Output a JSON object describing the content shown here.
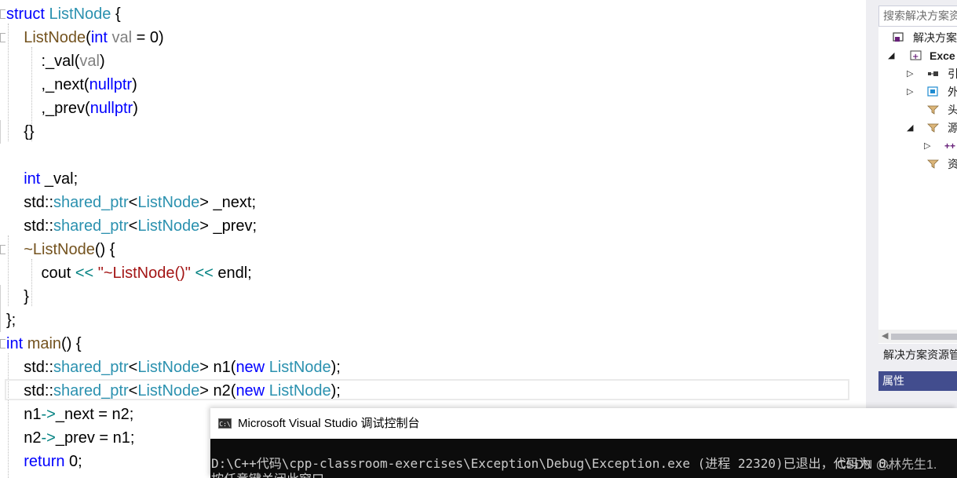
{
  "editor": {
    "lines": [
      [
        {
          "t": "struct",
          "c": "kw"
        },
        {
          "t": " "
        },
        {
          "t": "ListNode",
          "c": "ty"
        },
        {
          "t": " {"
        }
      ],
      [
        {
          "t": "    "
        },
        {
          "t": "ListNode",
          "c": "fn"
        },
        {
          "t": "("
        },
        {
          "t": "int",
          "c": "kw"
        },
        {
          "t": " "
        },
        {
          "t": "val",
          "c": "pr"
        },
        {
          "t": " = 0)"
        }
      ],
      [
        {
          "t": "        :_val("
        },
        {
          "t": "val",
          "c": "pr"
        },
        {
          "t": ")"
        }
      ],
      [
        {
          "t": "        ,_next("
        },
        {
          "t": "nullptr",
          "c": "kw"
        },
        {
          "t": ")"
        }
      ],
      [
        {
          "t": "        ,_prev("
        },
        {
          "t": "nullptr",
          "c": "kw"
        },
        {
          "t": ")"
        }
      ],
      [
        {
          "t": "    {}"
        }
      ],
      [],
      [
        {
          "t": "    "
        },
        {
          "t": "int",
          "c": "kw"
        },
        {
          "t": " _val;"
        }
      ],
      [
        {
          "t": "    std::"
        },
        {
          "t": "shared_ptr",
          "c": "ty"
        },
        {
          "t": "<"
        },
        {
          "t": "ListNode",
          "c": "ty"
        },
        {
          "t": "> _next;"
        }
      ],
      [
        {
          "t": "    std::"
        },
        {
          "t": "shared_ptr",
          "c": "ty"
        },
        {
          "t": "<"
        },
        {
          "t": "ListNode",
          "c": "ty"
        },
        {
          "t": "> _prev;"
        }
      ],
      [
        {
          "t": "    "
        },
        {
          "t": "~ListNode",
          "c": "fn"
        },
        {
          "t": "() {"
        }
      ],
      [
        {
          "t": "        cout "
        },
        {
          "t": "<<",
          "c": "op"
        },
        {
          "t": " "
        },
        {
          "t": "\"~ListNode()\"",
          "c": "st"
        },
        {
          "t": " "
        },
        {
          "t": "<<",
          "c": "op"
        },
        {
          "t": " endl;"
        }
      ],
      [
        {
          "t": "    }"
        }
      ],
      [
        {
          "t": "};"
        }
      ],
      [
        {
          "t": "int",
          "c": "kw"
        },
        {
          "t": " "
        },
        {
          "t": "main",
          "c": "fn"
        },
        {
          "t": "() {"
        }
      ],
      [
        {
          "t": "    std::"
        },
        {
          "t": "shared_ptr",
          "c": "ty"
        },
        {
          "t": "<"
        },
        {
          "t": "ListNode",
          "c": "ty"
        },
        {
          "t": "> n1("
        },
        {
          "t": "new",
          "c": "kw"
        },
        {
          "t": " "
        },
        {
          "t": "ListNode",
          "c": "ty"
        },
        {
          "t": ");"
        }
      ],
      [
        {
          "t": "    std::"
        },
        {
          "t": "shared_ptr",
          "c": "ty"
        },
        {
          "t": "<"
        },
        {
          "t": "ListNode",
          "c": "ty"
        },
        {
          "t": "> n2("
        },
        {
          "t": "new",
          "c": "kw"
        },
        {
          "t": " "
        },
        {
          "t": "ListNode",
          "c": "ty"
        },
        {
          "t": ");"
        }
      ],
      [
        {
          "t": "    n1"
        },
        {
          "t": "->",
          "c": "op"
        },
        {
          "t": "_next = n2;"
        }
      ],
      [
        {
          "t": "    n2"
        },
        {
          "t": "->",
          "c": "op"
        },
        {
          "t": "_prev = n1;"
        }
      ],
      [
        {
          "t": "    "
        },
        {
          "t": "return",
          "c": "kw"
        },
        {
          "t": " 0;"
        }
      ]
    ]
  },
  "solution_explorer": {
    "search_placeholder": "搜索解决方案资",
    "items": [
      {
        "label": "解决方案"
      },
      {
        "label": "Exce"
      },
      {
        "label": "引"
      },
      {
        "label": "外"
      },
      {
        "label": "头"
      },
      {
        "label": "源"
      },
      {
        "label": ""
      },
      {
        "label": "资"
      }
    ],
    "tab_label": "解决方案资源管",
    "properties_label": "属性"
  },
  "console": {
    "title": "Microsoft Visual Studio 调试控制台",
    "icon_text": "C:\\",
    "lines": [
      "D:\\C++代码\\cpp-classroom-exercises\\Exception\\Debug\\Exception.exe (进程 22320)已退出，代码为 0。",
      "按任意键关闭此窗口. . ."
    ]
  },
  "watermark": "CSDN @林先生1.",
  "colors": {
    "keyword": "#0000ff",
    "type": "#2b91af",
    "function": "#74531f",
    "parameter": "#808080",
    "string": "#a31515",
    "operator": "#008080",
    "change_bar": "#5cb85c",
    "properties_header": "#424d8e",
    "console_bg": "#0c0c0c"
  }
}
